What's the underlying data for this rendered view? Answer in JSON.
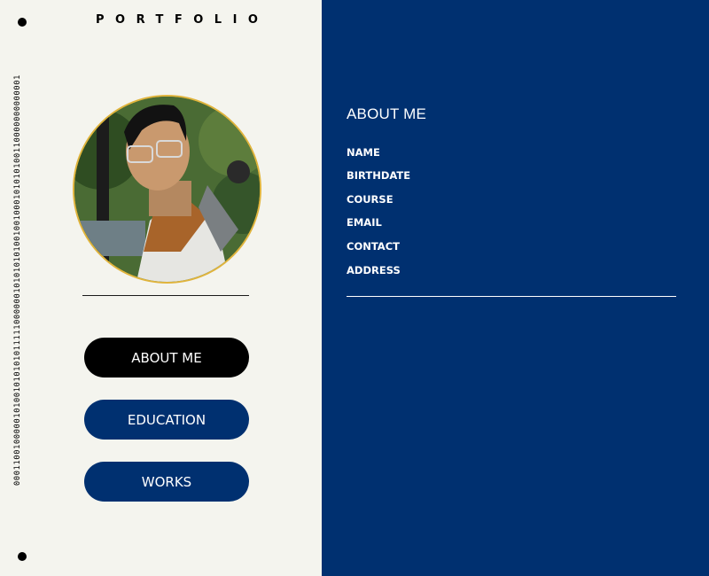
{
  "brand": {
    "title": "PORTFOLIO"
  },
  "decor": {
    "binary": "0001100100000101001010101011111000000101010101001001000101010100110000000000001"
  },
  "profile": {
    "photo_alt": "profile-photo"
  },
  "nav": {
    "about": "ABOUT ME",
    "education": "EDUCATION",
    "works": "WORKS"
  },
  "about": {
    "title": "ABOUT ME",
    "fields": [
      "NAME",
      "BIRTHDATE",
      "COURSE",
      "EMAIL",
      "CONTACT",
      "ADDRESS"
    ]
  },
  "colors": {
    "panel_bg": "#f4f4ee",
    "accent_blue": "#003070",
    "active_button": "#000000",
    "photo_border": "#e0b43c"
  }
}
